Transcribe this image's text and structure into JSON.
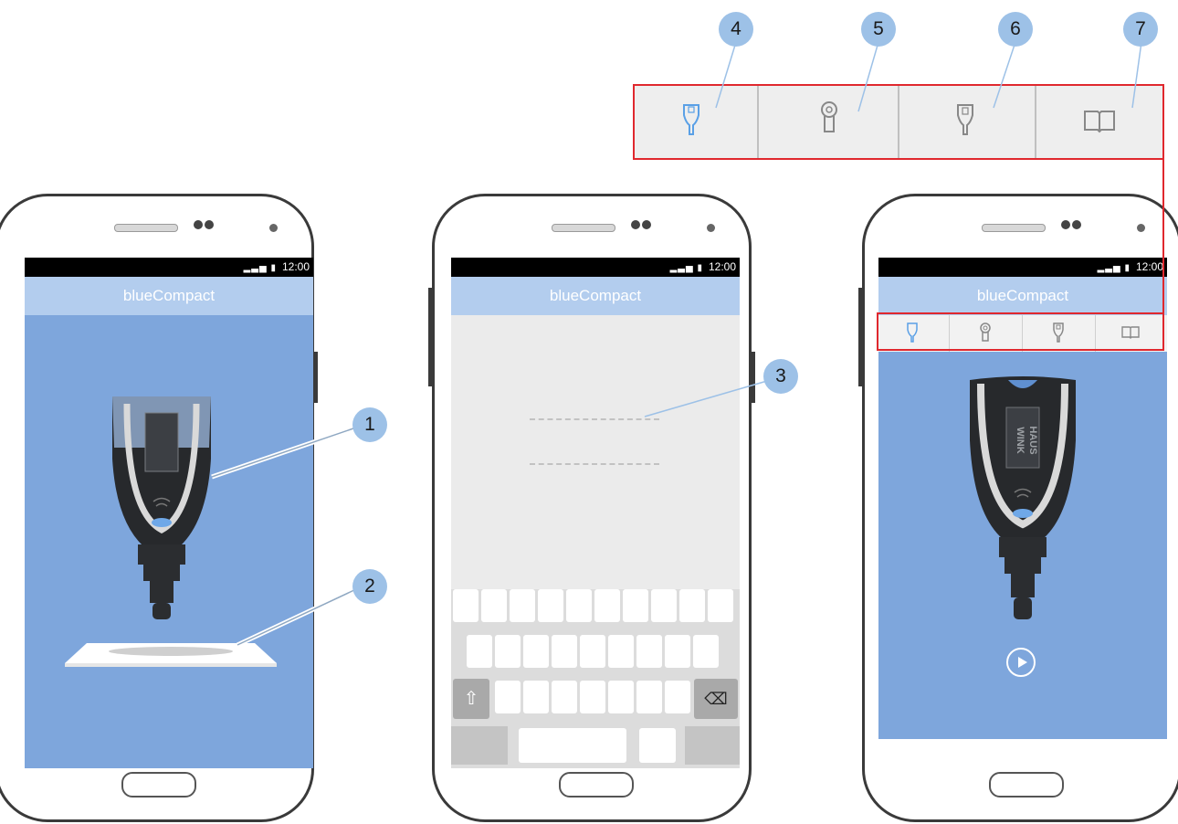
{
  "statusbar": {
    "time": "12:00"
  },
  "app": {
    "title": "blueCompact"
  },
  "callouts": [
    "1",
    "2",
    "3",
    "4",
    "5",
    "6",
    "7"
  ],
  "key_text": {
    "brand_line1": "WINK",
    "brand_line2": "HAUS"
  },
  "icons": {
    "tab1": "key-icon",
    "tab2": "cylinder-icon",
    "tab3": "key-fob-icon",
    "tab4": "book-icon",
    "play": "play-icon"
  },
  "colors": {
    "app_bar": "#b3cdee",
    "screen_background": "#7ea6dc",
    "callout": "#9dc1e7",
    "highlight_frame": "#e0282e",
    "active_tab_icon": "#5aa0e6"
  }
}
